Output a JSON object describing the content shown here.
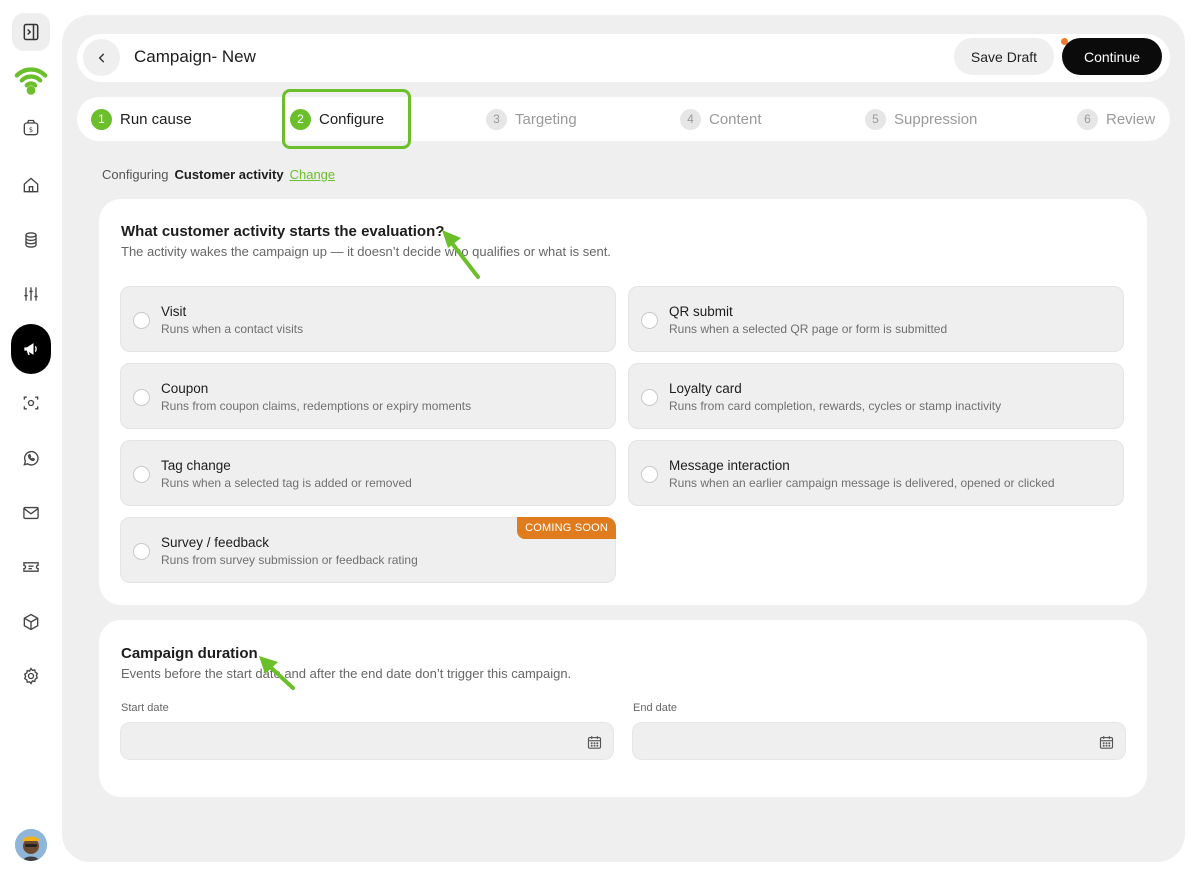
{
  "header": {
    "title": "Campaign- New",
    "save_draft_label": "Save Draft",
    "continue_label": "Continue"
  },
  "steps": [
    {
      "num": "1",
      "label": "Run cause",
      "state": "done"
    },
    {
      "num": "2",
      "label": "Configure",
      "state": "current"
    },
    {
      "num": "3",
      "label": "Targeting",
      "state": "upcoming"
    },
    {
      "num": "4",
      "label": "Content",
      "state": "upcoming"
    },
    {
      "num": "5",
      "label": "Suppression",
      "state": "upcoming"
    },
    {
      "num": "6",
      "label": "Review",
      "state": "upcoming"
    }
  ],
  "config": {
    "prefix": "Configuring",
    "value": "Customer activity",
    "change_label": "Change"
  },
  "activity": {
    "title": "What customer activity starts the evaluation?",
    "subtitle": "The activity wakes the campaign up — it doesn’t decide who qualifies or what is sent.",
    "options": [
      {
        "title": "Visit",
        "desc": "Runs when a contact visits"
      },
      {
        "title": "QR submit",
        "desc": "Runs when a selected QR page or form is submitted"
      },
      {
        "title": "Coupon",
        "desc": "Runs from coupon claims, redemptions or expiry moments"
      },
      {
        "title": "Loyalty card",
        "desc": "Runs from card completion, rewards, cycles or stamp inactivity"
      },
      {
        "title": "Tag change",
        "desc": "Runs when a selected tag is added or removed"
      },
      {
        "title": "Message interaction",
        "desc": "Runs when an earlier campaign message is delivered, opened or clicked"
      },
      {
        "title": "Survey / feedback",
        "desc": "Runs from survey submission or feedback rating",
        "badge": "COMING SOON"
      }
    ]
  },
  "duration": {
    "title": "Campaign duration",
    "subtitle": "Events before the start date and after the end date don’t trigger this campaign.",
    "start_label": "Start date",
    "start_value": "",
    "end_label": "End date",
    "end_value": ""
  },
  "colors": {
    "accent": "#6abf2a",
    "badge": "#e07c1e",
    "primary_button": "#0b0b0b",
    "panel": "#efefef"
  },
  "icons": [
    "sidebar-toggle-icon",
    "wifi-logo-icon",
    "wallet-icon",
    "home-icon",
    "database-icon",
    "sliders-icon",
    "megaphone-icon",
    "scan-icon",
    "whatsapp-icon",
    "mail-icon",
    "ticket-icon",
    "box-icon",
    "gear-icon",
    "chevron-left-icon",
    "calendar-icon"
  ]
}
